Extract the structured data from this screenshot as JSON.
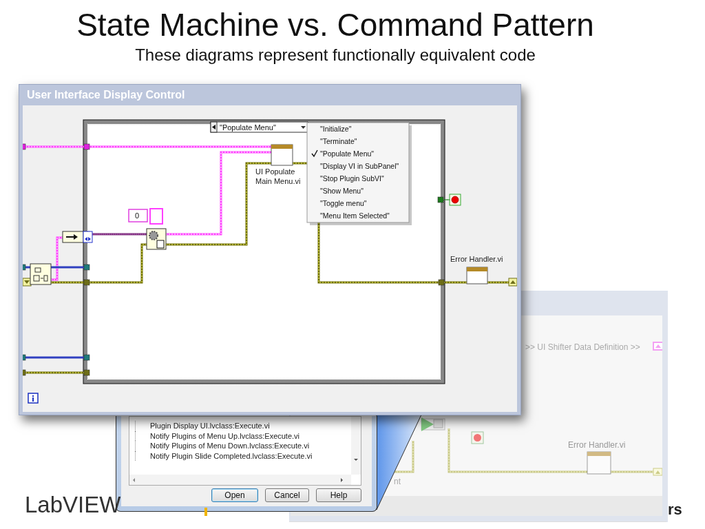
{
  "slide": {
    "title": "State Machine vs. Command Pattern",
    "subtitle": "These diagrams represent functionally equivalent code",
    "logo": "LabVIEW",
    "corner_text": "rs"
  },
  "back_window": {
    "terminal_label": ">> UI Shifter Data Definition >>",
    "error_handler_label": "Error Handler.vi",
    "partial_label": "nt"
  },
  "dialog": {
    "list_items": [
      "Plugin Display UI.lvclass:Execute.vi",
      "Notify Plugins of Menu Up.lvclass:Execute.vi",
      "Notify Plugins of Menu Down.lvclass:Execute.vi",
      "Notify Plugin Slide Completed.lvclass:Execute.vi"
    ],
    "buttons": [
      {
        "label": "Open",
        "default": true
      },
      {
        "label": "Cancel",
        "default": false
      },
      {
        "label": "Help",
        "default": false
      }
    ]
  },
  "front_window": {
    "title": "User Interface Display Control",
    "case_selector": "\"Populate Menu\"",
    "case_menu": [
      {
        "label": "\"Initialize\"",
        "selected": false
      },
      {
        "label": "\"Terminate\"",
        "selected": false
      },
      {
        "label": "\"Populate Menu\"",
        "selected": true
      },
      {
        "label": "\"Display VI in SubPanel\"",
        "selected": false
      },
      {
        "label": "\"Stop Plugin SubVI\"",
        "selected": false
      },
      {
        "label": "\"Show Menu\"",
        "selected": false
      },
      {
        "label": "\"Toggle menu\"",
        "selected": false
      },
      {
        "label": "\"Menu Item Selected\"",
        "selected": false
      }
    ],
    "subvi_label": [
      "UI Populate",
      "Main Menu.vi"
    ],
    "constant": "0",
    "error_handler_label": "Error Handler.vi"
  }
}
